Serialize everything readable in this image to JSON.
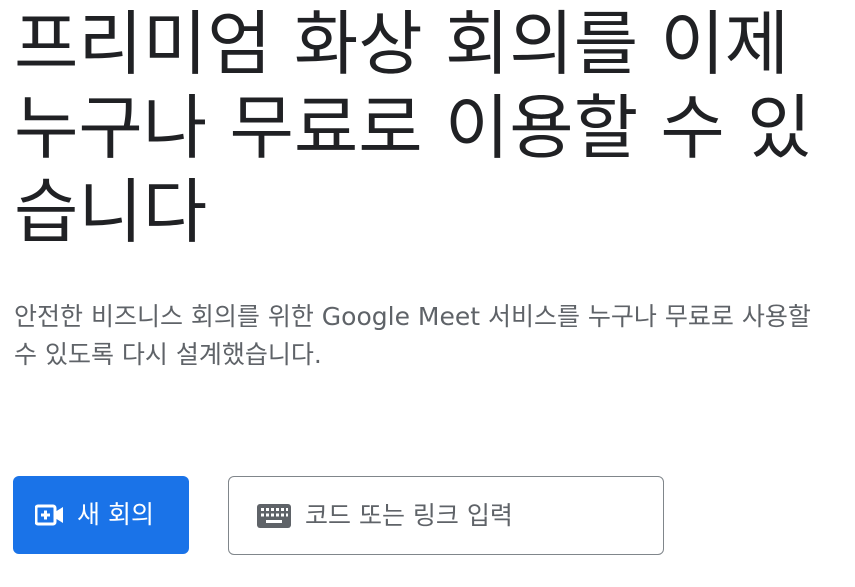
{
  "hero": {
    "title": "프리미엄 화상 회의를 이제 누구나 무료로 이용할 수 있습니다",
    "subtitle": "안전한 비즈니스 회의를 위한 Google Meet 서비스를 누구나 무료로 사용할 수 있도록 다시 설계했습니다."
  },
  "actions": {
    "new_meeting": {
      "label": "새 회의",
      "icon": "video-add-icon",
      "color": "#1a73e8"
    },
    "join": {
      "placeholder": "코드 또는 링크 입력",
      "value": "",
      "icon": "keyboard-icon"
    }
  },
  "colors": {
    "title": "#202124",
    "subtitle": "#5f6368",
    "accent": "#1a73e8",
    "input_border": "#80868b"
  }
}
